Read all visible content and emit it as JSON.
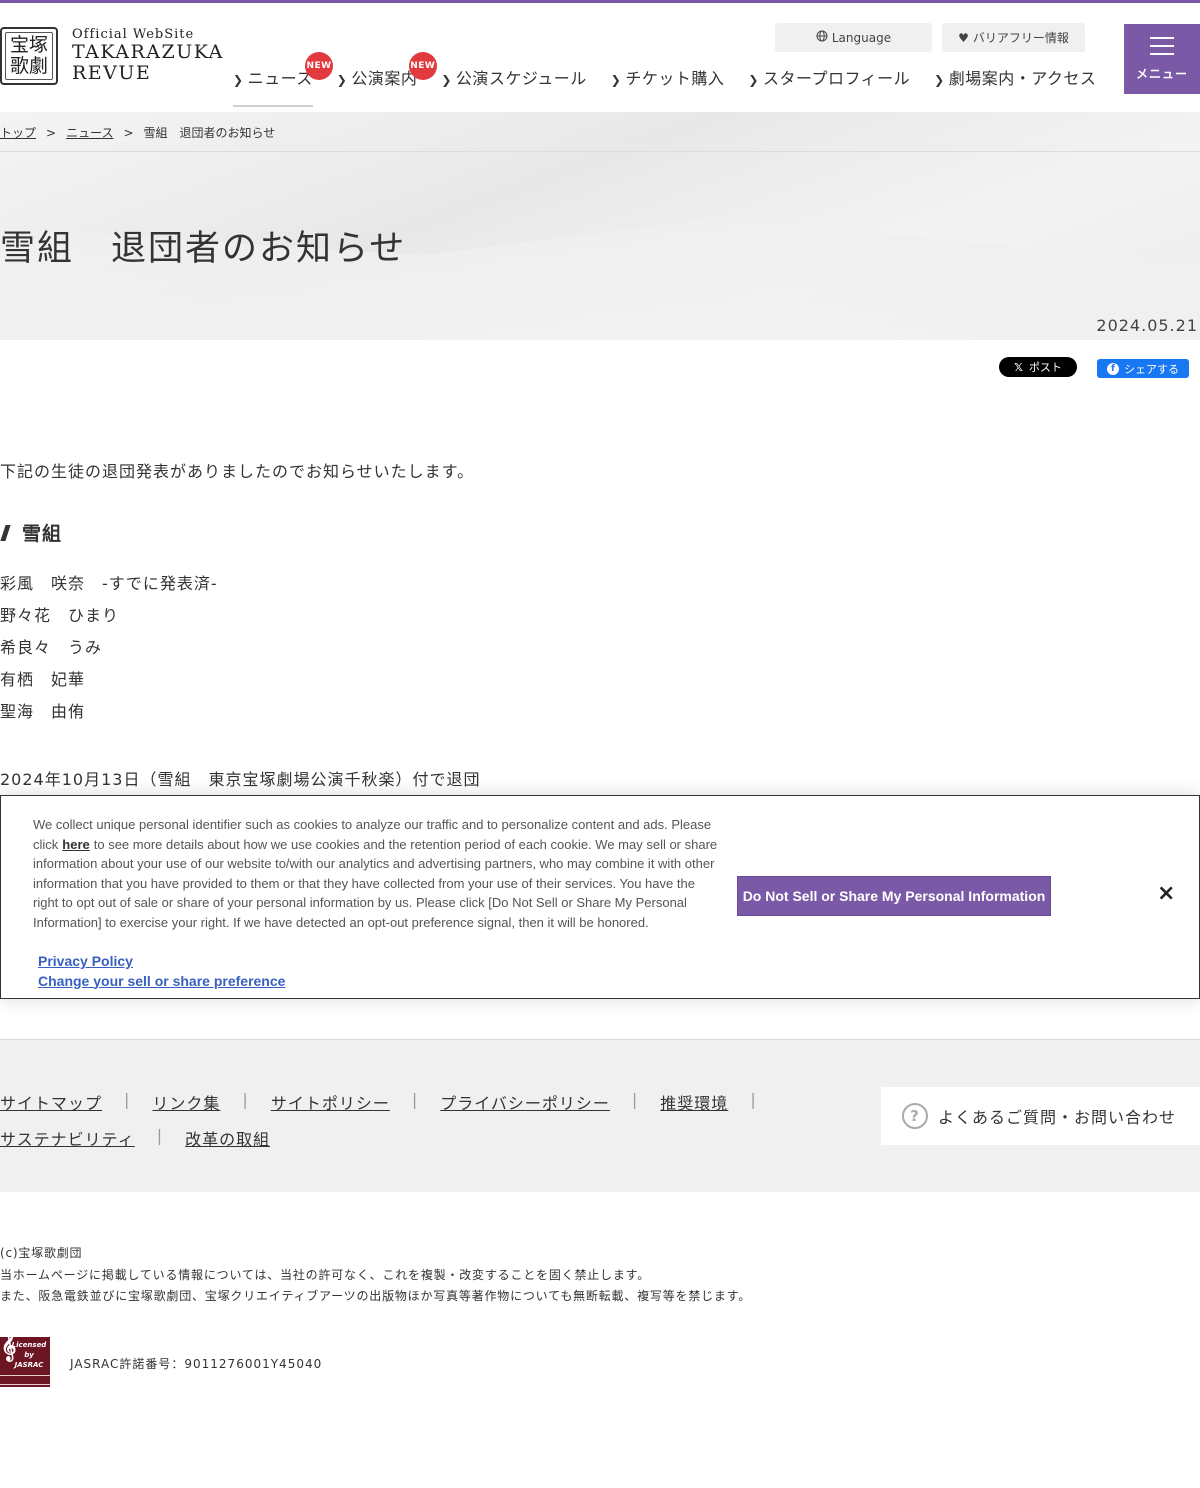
{
  "header": {
    "logo_seal_top": "宝塚",
    "logo_seal_bottom": "歌劇",
    "logo_small": "Official WebSite",
    "logo_line1": "TAKARAZUKA",
    "logo_line2": "REVUE",
    "language_label": "Language",
    "barrier_free_label": "バリアフリー情報",
    "menu_label": "メニュー",
    "nav": [
      {
        "label": "ニュース",
        "badge": "NEW"
      },
      {
        "label": "公演案内",
        "badge": "NEW"
      },
      {
        "label": "公演スケジュール"
      },
      {
        "label": "チケット購入"
      },
      {
        "label": "スタープロフィール"
      },
      {
        "label": "劇場案内・アクセス"
      }
    ]
  },
  "breadcrumb": {
    "top": "トップ",
    "news": "ニュース",
    "current": "雪組　退団者のお知らせ",
    "separator": ">"
  },
  "article": {
    "title": "雪組　退団者のお知らせ",
    "date": "2024.05.21",
    "share_x": "ポスト",
    "share_fb": "シェアする",
    "intro": "下記の生徒の退団発表がありましたのでお知らせいたします。",
    "section": "雪組",
    "members": [
      "彩風　咲奈　-すでに発表済-",
      "野々花　ひまり",
      "希良々　うみ",
      "有栖　妃華",
      "聖海　由侑"
    ],
    "retire_note": "2024年10月13日（雪組　東京宝塚劇場公演千秋楽）付で退団"
  },
  "cookie": {
    "text_before": "We collect unique personal identifier such as cookies to analyze our traffic and to personalize content and ads. Please click",
    "here": "here",
    "text_after": "to see more details about how we use cookies and the retention period of each cookie. We may sell or share information about your use of our website to/with our analytics and advertising partners, who may combine it with other information that you have provided to them or that they have collected from your use of their services. You have the right to opt out of sale or share of your personal information by us. Please click [Do Not Sell or Share My Personal Information] to exercise your right. If we have detected an opt-out preference signal, then it will be honored.",
    "privacy_link": "Privacy Policy",
    "change_link": "Change your sell or share preference",
    "button": "Do Not Sell or Share My Personal Information",
    "close": "×"
  },
  "footer": {
    "links_row1": [
      "サイトマップ",
      "リンク集",
      "サイトポリシー",
      "プライバシーポリシー",
      "推奨環境"
    ],
    "links_row2": [
      "サステナビリティ",
      "改革の取組"
    ],
    "faq": "よくあるご質問・お問い合わせ",
    "copyright": "(c)宝塚歌劇団",
    "notice1": "当ホームページに掲載している情報については、当社の許可なく、これを複製・改変することを固く禁止します。",
    "notice2": "また、阪急電鉄並びに宝塚歌劇団、宝塚クリエイティブアーツの出版物ほか写真等著作物についても無断転載、複写等を禁じます。",
    "jasrac_logo_1": "Licensed",
    "jasrac_logo_2": "by",
    "jasrac_logo_3": "JASRAC",
    "jasrac": "JASRAC許諾番号：9011276001Y45040"
  }
}
